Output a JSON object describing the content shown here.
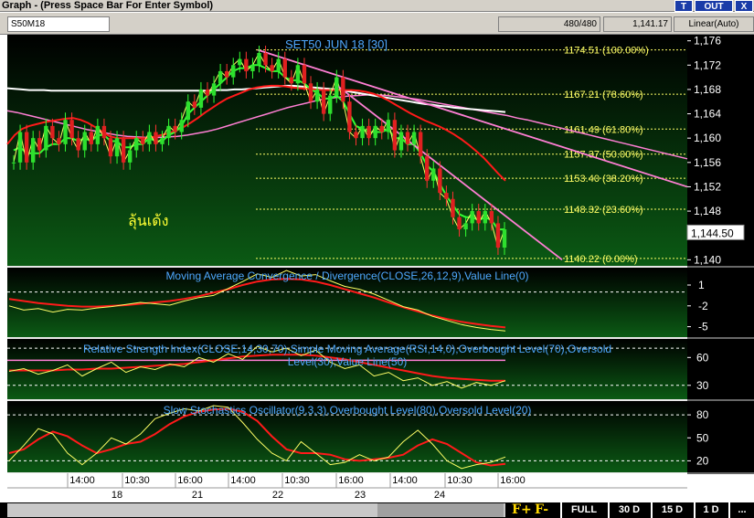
{
  "window": {
    "title": "Graph  - (Press Space Bar For Enter Symbol)",
    "btn_t": "T",
    "btn_out": "OUT",
    "btn_close": "X"
  },
  "infobar": {
    "symbol": "S50M18",
    "count": "480/480",
    "last": "1,141.17",
    "scale": "Linear(Auto)"
  },
  "chart_data": {
    "type": "line",
    "title": "SET50 JUN 18   [30]",
    "annotation": "ลุ้นเด้ง",
    "colors": {
      "bg_top": "#000000",
      "bg_bottom": "#0b5a14",
      "price": "#ffff66",
      "ema_green": "#33ff33",
      "ma_red": "#ff1a1a",
      "ma_white": "#ffffff",
      "ma_pink": "#ff7fd4",
      "fib": "#ffff66",
      "tick_text": "#ffffff",
      "axis_bg": "#000000",
      "label_text": "#4fa8ff"
    },
    "price_panel": {
      "ylim": [
        1139,
        1177
      ],
      "yticks": [
        1176,
        1172,
        1168,
        1164,
        1160,
        1156,
        1152,
        1148,
        1144,
        1140
      ],
      "ytick_labels": [
        "1,176",
        "1,172",
        "1,168",
        "1,164",
        "1,160",
        "1,156",
        "1,152",
        "1,148",
        "1,144",
        "1,140"
      ],
      "last_value": "1,144.50",
      "fib_levels": [
        {
          "value": 1174.51,
          "label": "1174.51 (100.00%)"
        },
        {
          "value": 1167.21,
          "label": "1167.21 (78.60%)"
        },
        {
          "value": 1161.49,
          "label": "1161.49 (61.80%)"
        },
        {
          "value": 1157.37,
          "label": "1157.37 (50.00%)"
        },
        {
          "value": 1153.4,
          "label": "1153.40 (38.20%)"
        },
        {
          "value": 1148.32,
          "label": "1148.32 (23.60%)"
        },
        {
          "value": 1140.22,
          "label": "1140.22 (0.00%)"
        }
      ],
      "price": [
        1156,
        1161,
        1156,
        1160,
        1158,
        1162,
        1160,
        1159,
        1163,
        1160,
        1158,
        1161,
        1159,
        1162,
        1160,
        1157,
        1160,
        1156,
        1158,
        1160,
        1159,
        1161,
        1159,
        1160,
        1162,
        1161,
        1163,
        1166,
        1165,
        1168,
        1167,
        1169,
        1171,
        1170,
        1172,
        1173,
        1171,
        1172,
        1174,
        1172,
        1171,
        1173,
        1170,
        1169,
        1172,
        1169,
        1166,
        1168,
        1164,
        1167,
        1170,
        1166,
        1161,
        1160,
        1162,
        1160,
        1162,
        1161,
        1163,
        1158,
        1161,
        1159,
        1161,
        1157,
        1153,
        1155,
        1151,
        1150,
        1147,
        1145,
        1146,
        1148,
        1146,
        1148,
        1146,
        1142,
        1145
      ],
      "ema": [
        1158,
        1158.5,
        1157.5,
        1157.5,
        1157.5,
        1158.5,
        1159,
        1159,
        1160,
        1160,
        1159.5,
        1160,
        1159.5,
        1160.5,
        1160.5,
        1159.5,
        1159.5,
        1158.5,
        1158.5,
        1159,
        1159,
        1160,
        1159.5,
        1159.5,
        1160.5,
        1161,
        1162,
        1164,
        1165,
        1166,
        1167,
        1168,
        1169,
        1170,
        1171,
        1171.5,
        1171.5,
        1172,
        1172,
        1171.5,
        1171,
        1171,
        1170,
        1169.5,
        1169.5,
        1169,
        1168,
        1167.5,
        1166.5,
        1166.5,
        1167,
        1166,
        1164,
        1162,
        1161.5,
        1161,
        1161,
        1161,
        1161.5,
        1160,
        1160,
        1159,
        1159,
        1157.5,
        1155.5,
        1154.5,
        1152.5,
        1150.5,
        1149,
        1147.5,
        1147,
        1147,
        1146.5,
        1147,
        1146.5,
        1145,
        1145
      ],
      "ma_red": [
        1159,
        1160.5,
        1161.5,
        1162,
        1162.3,
        1162.6,
        1162.8,
        1163,
        1163.2,
        1163.3,
        1163,
        1162.5,
        1161.8,
        1161,
        1160.3,
        1160,
        1160,
        1160,
        1160,
        1160,
        1160.2,
        1160.5,
        1160.8,
        1161.2,
        1161.8,
        1162.5,
        1163.3,
        1164.2,
        1165,
        1165.8,
        1166.5,
        1167,
        1167.5,
        1168,
        1168.3,
        1168.5,
        1168.6,
        1168.6,
        1168.5,
        1168.3,
        1168.2,
        1168.1,
        1168,
        1167.9,
        1167.9,
        1167.9,
        1167.9,
        1167.9,
        1167.8,
        1167.6,
        1167.3,
        1166.8,
        1166.2,
        1165.5,
        1164.8,
        1164.1,
        1163.5,
        1162.9,
        1162.4,
        1161.9,
        1161.3,
        1160.6,
        1159.8,
        1158.9,
        1157.9,
        1156.8,
        1155.5,
        1154.2,
        1153
      ],
      "ma_white": [
        1168.2,
        1168.1,
        1168,
        1167.9,
        1167.9,
        1167.9,
        1167.8,
        1167.8,
        1167.8,
        1167.8,
        1167.8,
        1167.8,
        1167.8,
        1167.8,
        1167.8,
        1167.8,
        1167.8,
        1167.8,
        1167.8,
        1167.8,
        1167.8,
        1167.8,
        1167.8,
        1167.8,
        1167.8,
        1167.8,
        1167.8,
        1167.8,
        1167.9,
        1167.9,
        1167.9,
        1168,
        1168,
        1168.1,
        1168.2,
        1168.3,
        1168.4,
        1168.5,
        1168.6,
        1168.6,
        1168.5,
        1168.4,
        1168.3,
        1168.2,
        1168.1,
        1168,
        1167.8,
        1167.6,
        1167.4,
        1167.2,
        1167,
        1166.8,
        1166.6,
        1166.4,
        1166.2,
        1166,
        1165.8,
        1165.6,
        1165.5,
        1165.3,
        1165.2,
        1165,
        1164.9,
        1164.8,
        1164.7,
        1164.6,
        1164.5,
        1164.4,
        1164.3
      ],
      "ma_pink": [
        1164.5,
        1164.2,
        1163.8,
        1163.4,
        1163,
        1162.6,
        1162.2,
        1161.8,
        1161.4,
        1161.1,
        1160.8,
        1160.5,
        1160.3,
        1160.2,
        1160.1,
        1160.1,
        1160.2,
        1160.3,
        1160.5,
        1160.8,
        1161.1,
        1161.5,
        1162,
        1162.5,
        1163,
        1163.5,
        1164,
        1164.5,
        1165,
        1165.4,
        1165.8,
        1166.2,
        1166.5,
        1166.7,
        1166.9,
        1167,
        1167.1,
        1167.1,
        1167,
        1166.8,
        1166.6,
        1166.4,
        1166.1,
        1165.8,
        1165.5,
        1165.2,
        1164.9,
        1164.6,
        1164.3,
        1164,
        1163.7,
        1163.3,
        1163,
        1162.6,
        1162.2,
        1161.8,
        1161.4,
        1161,
        1160.6,
        1160.2,
        1159.8,
        1159.4,
        1159,
        1158.6,
        1158.2,
        1157.8,
        1157.4,
        1157,
        1156.6
      ],
      "trend_lines": [
        [
          1174.5,
          1152
        ],
        [
          1168.5,
          1140
        ]
      ]
    },
    "macd_panel": {
      "label": "Moving Average Convergence / Divergence(CLOSE,26,12,9),Value Line(0)",
      "ylim": [
        -6.5,
        3.5
      ],
      "yticks": [
        1,
        -2,
        -5
      ],
      "ytick_labels": [
        "1",
        "-2",
        "-5"
      ],
      "macd": [
        -2,
        -2.6,
        -2.4,
        -2.9,
        -2.5,
        -2.6,
        -2.3,
        -2.1,
        -1.8,
        -1.5,
        -1.7,
        -1.9,
        -1.3,
        -0.8,
        -0.5,
        0.5,
        1.5,
        2.6,
        2.1,
        3.1,
        2.3,
        2.5,
        1.6,
        0.8,
        0.4,
        -0.3,
        -1.2,
        -2.1,
        -2.6,
        -3.5,
        -4.1,
        -4.7,
        -5.1,
        -5.4,
        -5.6
      ],
      "signal": [
        -1,
        -1.3,
        -1.6,
        -1.8,
        -2,
        -2.1,
        -2.1,
        -2,
        -1.9,
        -1.7,
        -1.5,
        -1.3,
        -1,
        -0.6,
        -0.1,
        0.4,
        1,
        1.5,
        1.8,
        1.9,
        1.8,
        1.5,
        1,
        0.4,
        -0.2,
        -0.8,
        -1.5,
        -2.2,
        -2.8,
        -3.4,
        -3.9,
        -4.3,
        -4.6,
        -4.9,
        -5.1
      ]
    },
    "rsi_panel": {
      "label_line1": "Relative Strength Index(CLOSE,14,30,70),Simple Moving Average(RSI,14,0),Overbought Level(70),Oversold",
      "label_line2": "Level(30),Value Line(50)",
      "ylim": [
        15,
        80
      ],
      "yticks": [
        60,
        30
      ],
      "ytick_labels": [
        "60",
        "30"
      ],
      "rsi": [
        45,
        48,
        42,
        46,
        52,
        40,
        48,
        55,
        44,
        50,
        47,
        53,
        50,
        60,
        55,
        64,
        58,
        72,
        66,
        70,
        62,
        68,
        55,
        48,
        52,
        40,
        44,
        35,
        38,
        30,
        34,
        27,
        33,
        30,
        35
      ],
      "rsi_sma": [
        46,
        46,
        46,
        46,
        47,
        47,
        48,
        48,
        49,
        50,
        51,
        52,
        53,
        55,
        57,
        59,
        61,
        62,
        63,
        63,
        63,
        62,
        60,
        58,
        55,
        52,
        49,
        46,
        43,
        40,
        38,
        37,
        36,
        35,
        35
      ],
      "levels": [
        70,
        30
      ]
    },
    "stoch_panel": {
      "label": "Slow Stochastics Oscillator(9,3,3),Overbought Level(80),Oversold Level(20)",
      "ylim": [
        5,
        98
      ],
      "yticks": [
        80,
        50,
        20
      ],
      "ytick_labels": [
        "80",
        "50",
        "20"
      ],
      "k": [
        20,
        40,
        62,
        55,
        30,
        15,
        30,
        50,
        42,
        55,
        75,
        82,
        88,
        85,
        92,
        90,
        70,
        48,
        30,
        20,
        45,
        30,
        15,
        18,
        28,
        20,
        25,
        45,
        60,
        42,
        20,
        10,
        15,
        18,
        25
      ],
      "d": [
        30,
        35,
        48,
        58,
        52,
        40,
        30,
        35,
        42,
        45,
        55,
        68,
        78,
        84,
        87,
        88,
        84,
        72,
        52,
        35,
        30,
        30,
        28,
        22,
        20,
        22,
        24,
        28,
        40,
        48,
        42,
        30,
        18,
        14,
        16
      ],
      "levels": [
        80,
        20
      ]
    },
    "x_axis": {
      "time_labels": [
        "14:00",
        "10:30",
        "16:00",
        "14:00",
        "10:30",
        "16:00",
        "14:00",
        "10:30",
        "16:00"
      ],
      "day_labels": [
        "18",
        "21",
        "22",
        "23",
        "24"
      ]
    }
  },
  "nav": {
    "fplus": "F+",
    "fminus": "F-",
    "full": "FULL",
    "d30": "30 D",
    "d15": "15 D",
    "d1": "1 D",
    "more": "..."
  }
}
